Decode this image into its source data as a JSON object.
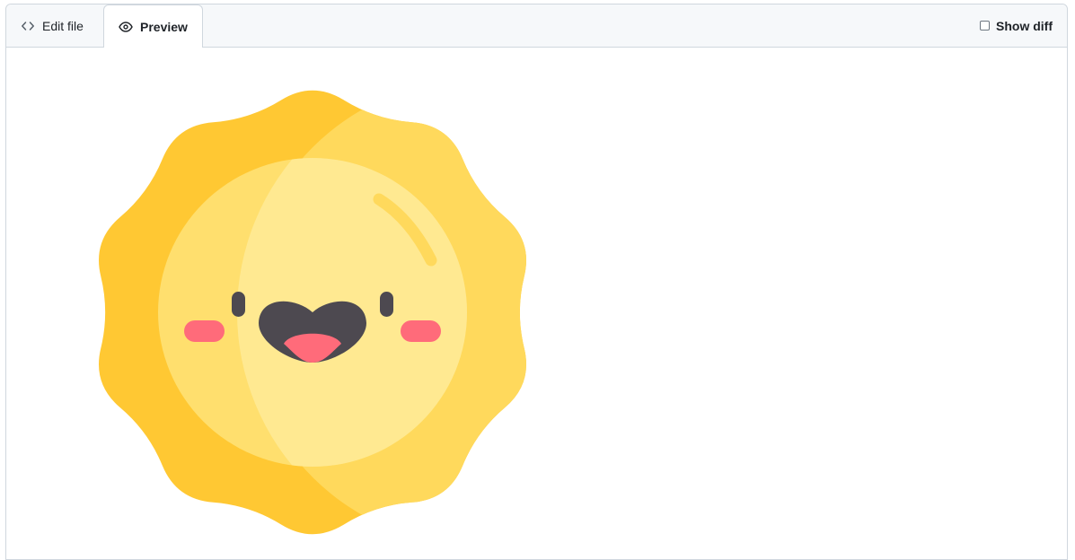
{
  "tabs": {
    "edit_label": "Edit file",
    "preview_label": "Preview"
  },
  "toolbar": {
    "show_diff_label": "Show diff"
  },
  "icons": {
    "edit": "code-icon",
    "preview": "eye-icon",
    "image": "sun-emoji-icon"
  },
  "colors": {
    "sun_outer": "#FFC833",
    "sun_outer_light": "#FFD95C",
    "sun_inner": "#FFDF6E",
    "sun_face": "#FFE991",
    "features": "#4D4950",
    "cheeks": "#FF6B7A",
    "tongue": "#FF6B7A"
  }
}
